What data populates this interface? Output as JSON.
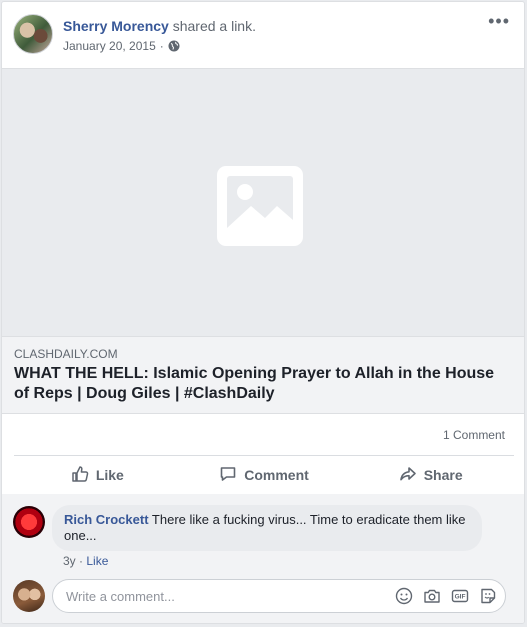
{
  "post": {
    "author": "Sherry Morency",
    "action_text": "shared a link.",
    "date": "January 20, 2015",
    "meta_separator": "·",
    "more_label": "•••"
  },
  "link": {
    "domain": "CLASHDAILY.COM",
    "title": "WHAT THE HELL: Islamic Opening Prayer to Allah in the House of Reps | Doug Giles | #ClashDaily"
  },
  "stats": {
    "comments_count": "1 Comment"
  },
  "actions": {
    "like": "Like",
    "comment": "Comment",
    "share": "Share"
  },
  "comments": [
    {
      "author": "Rich Crockett",
      "text": "There like a fucking virus... Time to eradicate them like one...",
      "age": "3y",
      "separator": "·",
      "like_label": "Like"
    }
  ],
  "composer": {
    "placeholder": "Write a comment..."
  },
  "icons": {
    "privacy": "globe-icon",
    "link_placeholder": "image-placeholder-icon",
    "like": "thumbs-up-icon",
    "comment": "comment-bubble-icon",
    "share": "share-arrow-icon",
    "composer": [
      "emoji-icon",
      "camera-icon",
      "gif-icon",
      "sticker-icon"
    ]
  },
  "colors": {
    "link_blue": "#385898",
    "secondary_text": "#606770",
    "background": "#e9ebee"
  }
}
